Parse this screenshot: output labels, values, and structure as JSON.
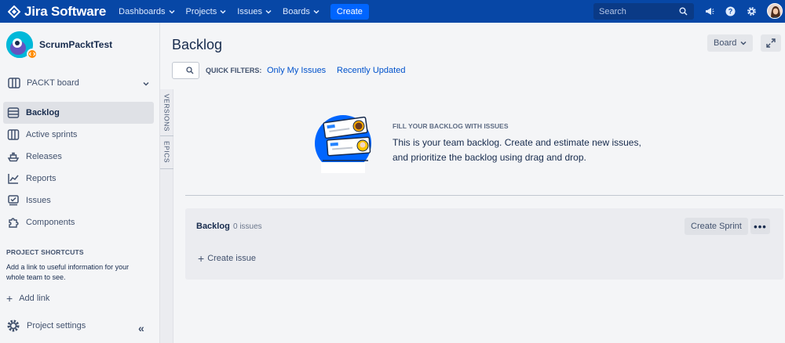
{
  "topnav": {
    "product": "Jira Software",
    "items": [
      {
        "label": "Dashboards"
      },
      {
        "label": "Projects"
      },
      {
        "label": "Issues"
      },
      {
        "label": "Boards"
      }
    ],
    "create_label": "Create",
    "search_placeholder": "Search",
    "icons": [
      "megaphone-icon",
      "help-icon",
      "settings-icon",
      "user-avatar"
    ]
  },
  "sidebar": {
    "project_name": "ScrumPacktTest",
    "board_selector": "PACKT board",
    "items": [
      {
        "label": "Backlog",
        "icon": "backlog-icon",
        "active": true
      },
      {
        "label": "Active sprints",
        "icon": "board-columns-icon"
      },
      {
        "label": "Releases",
        "icon": "ship-icon"
      },
      {
        "label": "Reports",
        "icon": "chart-icon"
      },
      {
        "label": "Issues",
        "icon": "issues-icon"
      },
      {
        "label": "Components",
        "icon": "puzzle-icon"
      }
    ],
    "shortcuts_heading": "PROJECT SHORTCUTS",
    "shortcuts_description": "Add a link to useful information for your whole team to see.",
    "add_link_label": "Add link",
    "settings_label": "Project settings"
  },
  "main": {
    "title": "Backlog",
    "board_button": "Board",
    "quick_filters_label": "QUICK FILTERS:",
    "quick_filters": [
      {
        "label": "Only My Issues"
      },
      {
        "label": "Recently Updated"
      }
    ],
    "side_tabs": [
      {
        "label": "VERSIONS"
      },
      {
        "label": "EPICS"
      }
    ],
    "empty_state": {
      "heading": "FILL YOUR BACKLOG WITH ISSUES",
      "text": "This is your team backlog. Create and estimate new issues, and prioritize the backlog using drag and drop."
    },
    "backlog": {
      "title": "Backlog",
      "count": "0 issues",
      "create_sprint": "Create Sprint",
      "more": "•••",
      "create_issue": "Create issue"
    }
  },
  "colors": {
    "nav_bg": "#0747a6",
    "create_button": "#0065ff",
    "link": "#0052cc",
    "sidebar_active": "#dfe1e6"
  }
}
